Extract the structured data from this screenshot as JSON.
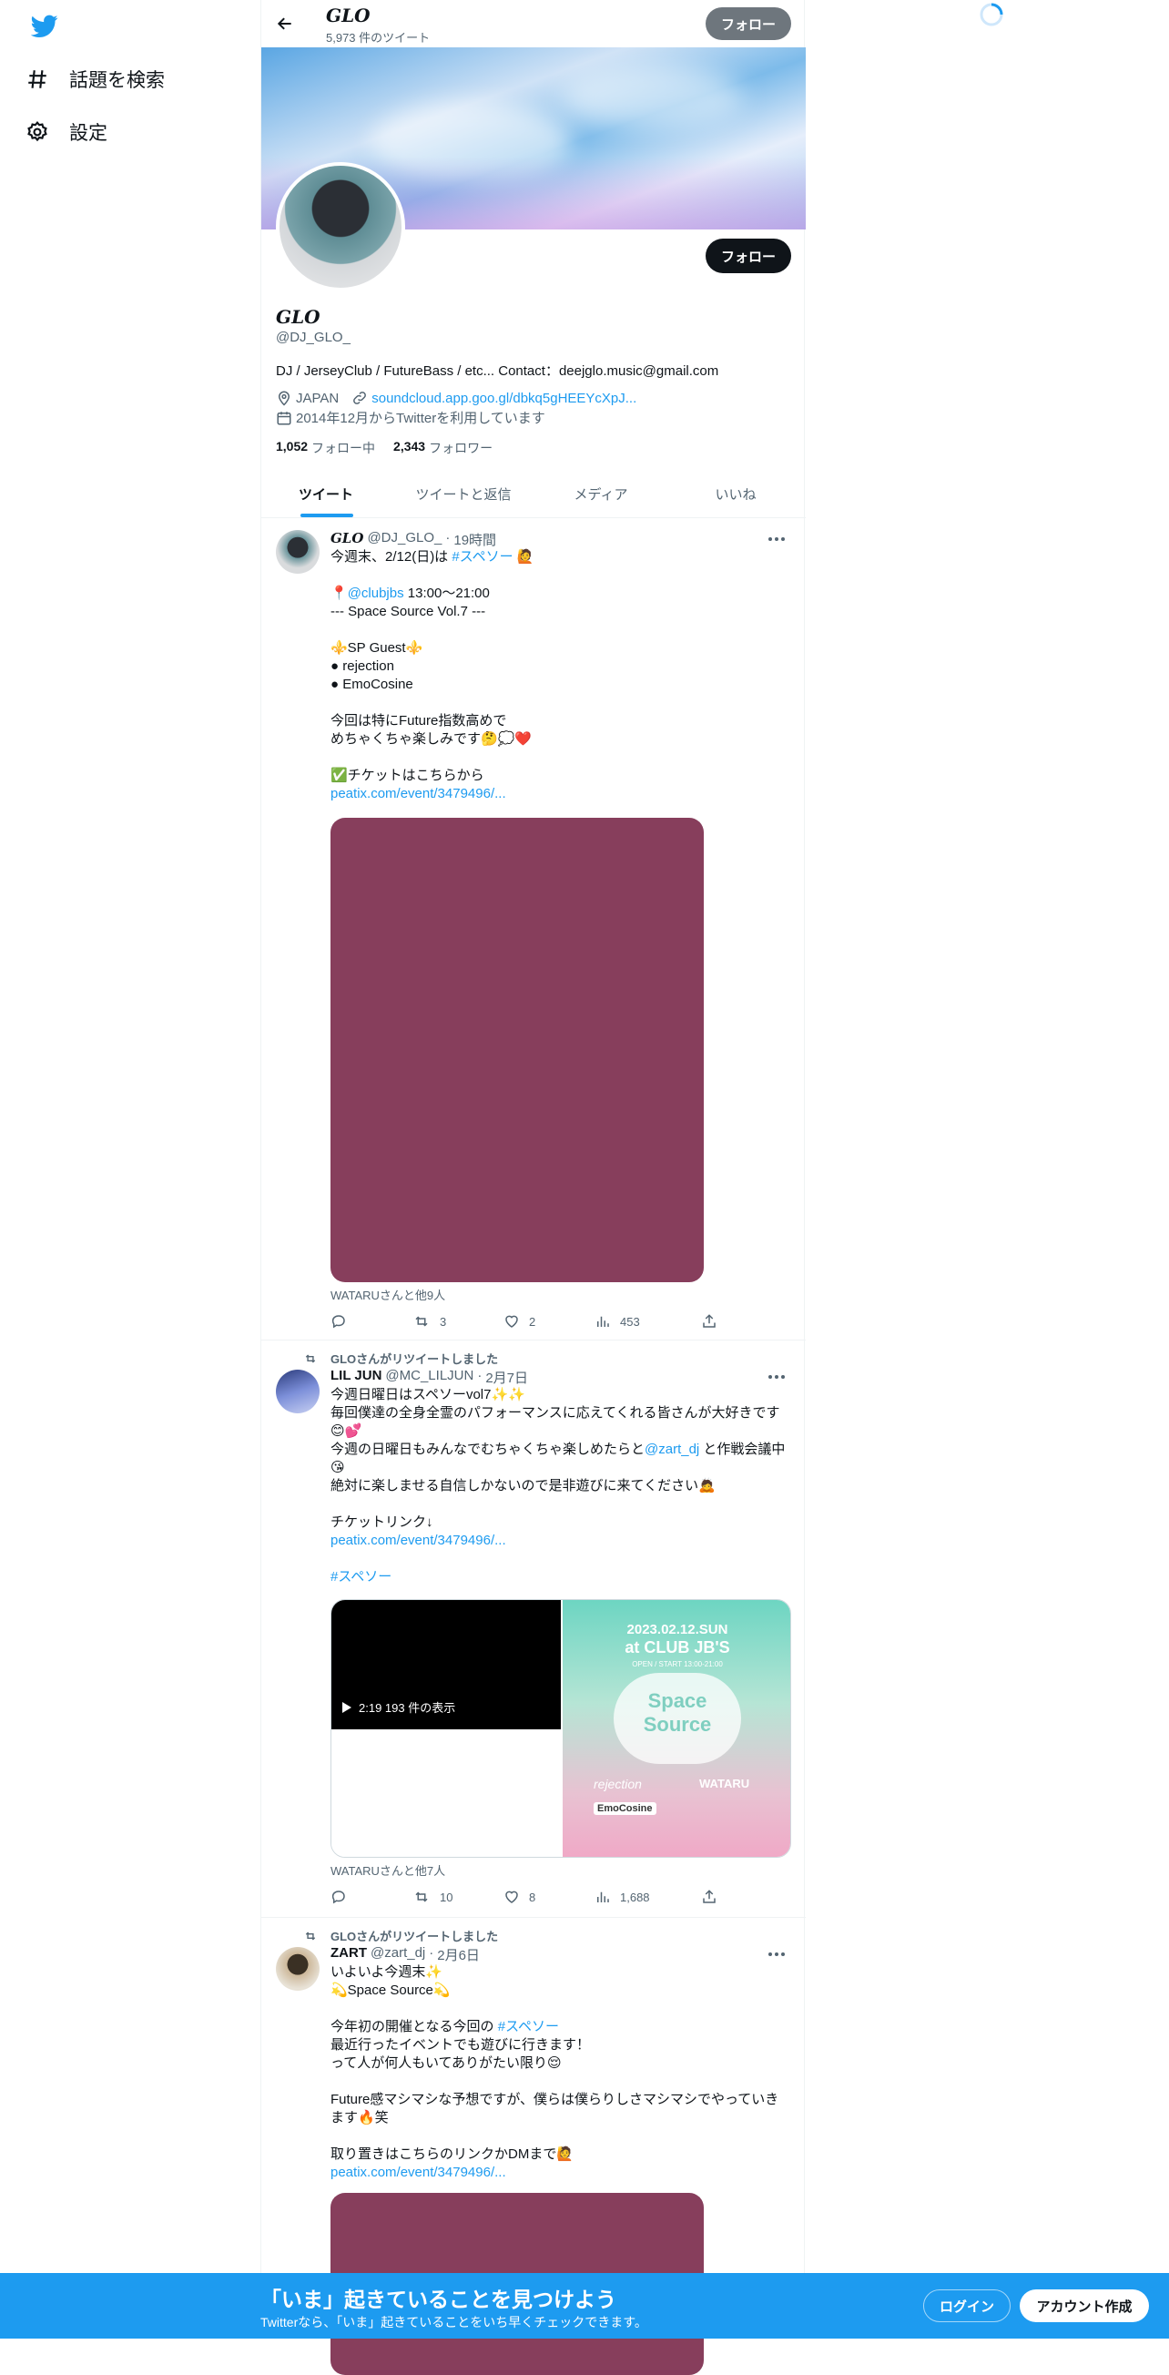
{
  "nav": {
    "explore": "話題を検索",
    "settings": "設定"
  },
  "header": {
    "name": "GLO",
    "tweet_count": "5,973 件のツイート",
    "follow": "フォロー"
  },
  "profile": {
    "name": "GLO",
    "handle": "@DJ_GLO_",
    "follow": "フォロー",
    "bio": "DJ / JerseyClub / FutureBass / etc... Contact：deejglo.music@gmail.com",
    "location": "JAPAN",
    "link": "soundcloud.app.goo.gl/dbkq5gHEEYcXpJ...",
    "joined": "2014年12月からTwitterを利用しています",
    "following_count": "1,052",
    "following_label": "フォロー中",
    "followers_count": "2,343",
    "followers_label": "フォロワー"
  },
  "tabs": [
    "ツイート",
    "ツイートと返信",
    "メディア",
    "いいね"
  ],
  "tweets": [
    {
      "name": "GLO",
      "handle": "@DJ_GLO_",
      "time": "19時間",
      "text_line1": "今週末、2/12(日)は ",
      "hashtag1": "#スペソー",
      "text_line1_end": " 🙋",
      "pin_line_a": "📍",
      "pin_mention": "@clubjbs",
      "pin_line_b": " 13:00〜21:00",
      "body": "--- Space Source Vol.7 ---\n\n⚜️SP Guest⚜️\n● rejection\n● EmoCosine\n\n今回は特にFuture指数高めで\nめちゃくちゃ楽しみです🤔💭❤️\n\n✅チケットはこちらから",
      "link": "peatix.com/event/3479496/...",
      "tagged": "WATARUさんと他9人",
      "retweets": "3",
      "likes": "2",
      "views": "453"
    },
    {
      "retweeted_by": "GLOさんがリツイートしました",
      "name": "LIL JUN",
      "handle": "@MC_LILJUN",
      "time": "2月7日",
      "text_a": "今週日曜日はスペソーvol7✨✨\n毎回僕達の全身全霊のパフォーマンスに応えてくれる皆さんが大好きです😊💕\n今週の日曜日もみんなでむちゃくちゃ楽しめたらと",
      "mention": "@zart_dj",
      "text_b": " と作戦会議中😘\n絶対に楽しませる自信しかないので是非遊びに来てください🙇\n\nチケットリンク↓",
      "link": "peatix.com/event/3479496/...",
      "hashtag": "#スペソー",
      "video_label": "2:19  193 件の表示",
      "poster": {
        "date": "2023.02.12.SUN",
        "venue": "at CLUB JB'S",
        "open": "OPEN / START 13:00-21:00",
        "title1": "Space",
        "title2": "Source",
        "guest1": "rejection",
        "guest2": "WATARU",
        "guest3": "EmoCosine"
      },
      "tagged": "WATARUさんと他7人",
      "retweets": "10",
      "likes": "8",
      "views": "1,688"
    },
    {
      "retweeted_by": "GLOさんがリツイートしました",
      "name": "ZART",
      "handle": "@zart_dj",
      "time": "2月6日",
      "text_a": "いよいよ今週末✨\n💫Space Source💫\n\n今年初の開催となる今回の ",
      "hashtag": "#スペソー",
      "text_b": "\n最近行ったイベントでも遊びに行きます！\nって人が何人もいてありがたい限り😌\n\nFuture感マシマシな予想ですが、僕らは僕らりしさマシマシでやっていきます🔥笑\n\n取り置きはこちらのリンクかDMまで🙋",
      "link": "peatix.com/event/3479496/..."
    }
  ],
  "bottom": {
    "headline": "「いま」起きていることを見つけよう",
    "sub": "Twitterなら、「いま」起きていることをいち早くチェックできます。",
    "login": "ログイン",
    "signup": "アカウント作成"
  },
  "colors": {
    "accent": "#1d9bf0",
    "dark": "#0f1419",
    "media_placeholder": "#873e5c"
  }
}
